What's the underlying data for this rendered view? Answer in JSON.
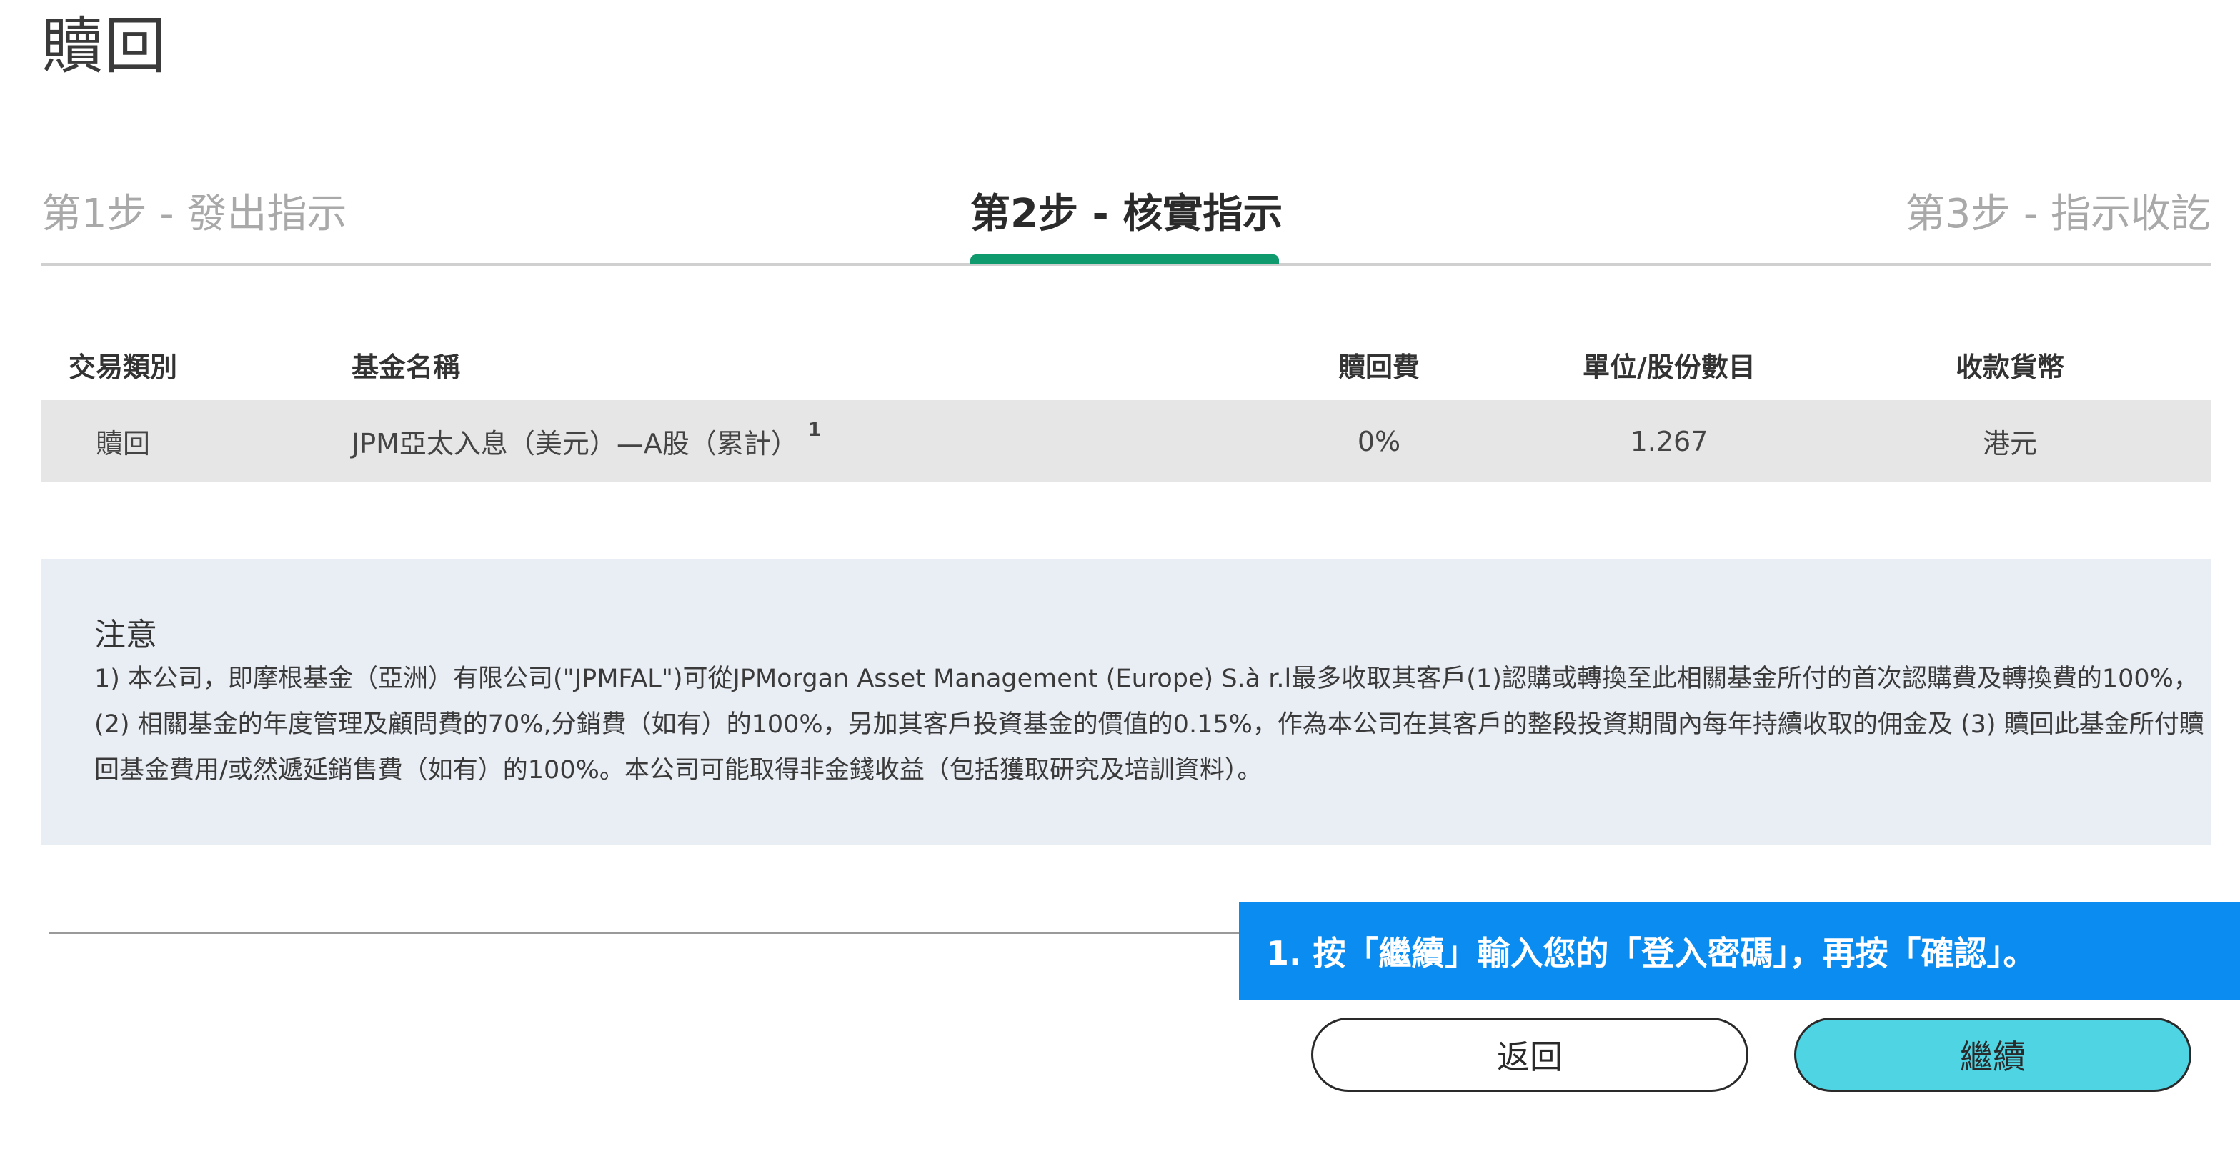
{
  "page": {
    "title": "贖回"
  },
  "stepper": {
    "steps": [
      {
        "label": "第1步 - 發出指示",
        "state": "inactive"
      },
      {
        "label": "第2步 - 核實指示",
        "state": "active"
      },
      {
        "label": "第3步 - 指示收訖",
        "state": "inactive"
      }
    ],
    "active_color": "#0f9a6e"
  },
  "table": {
    "headers": {
      "type": "交易類別",
      "name": "基金名稱",
      "fee": "贖回費",
      "units": "單位/股份數目",
      "currency": "收款貨幣"
    },
    "rows": [
      {
        "type": "贖回",
        "name": "JPM亞太入息（美元）—A股（累計）",
        "footnote": "1",
        "fee": "0%",
        "units": "1.267",
        "currency": "港元"
      }
    ]
  },
  "notice": {
    "title": "注意",
    "body": "1) 本公司，即摩根基金（亞洲）有限公司(\"JPMFAL\")可從JPMorgan Asset Management (Europe) S.à r.l最多收取其客戶(1)認購或轉換至此相關基金所付的首次認購費及轉換費的100%，(2) 相關基金的年度管理及顧問費的70%,分銷費（如有）的100%，另加其客戶投資基金的價值的0.15%，作為本公司在其客戶的整段投資期間內每年持續收取的佣金及 (3) 贖回此基金所付贖回基金費用/或然遞延銷售費（如有）的100%。本公司可能取得非金錢收益（包括獲取研究及培訓資料）。"
  },
  "hint": {
    "text": "1. 按「繼續」輸入您的「登入密碼」，再按「確認」。",
    "color": "#0a8cf0"
  },
  "buttons": {
    "back_label": "返回",
    "continue_label": "繼續",
    "continue_color": "#4fd4e4"
  }
}
